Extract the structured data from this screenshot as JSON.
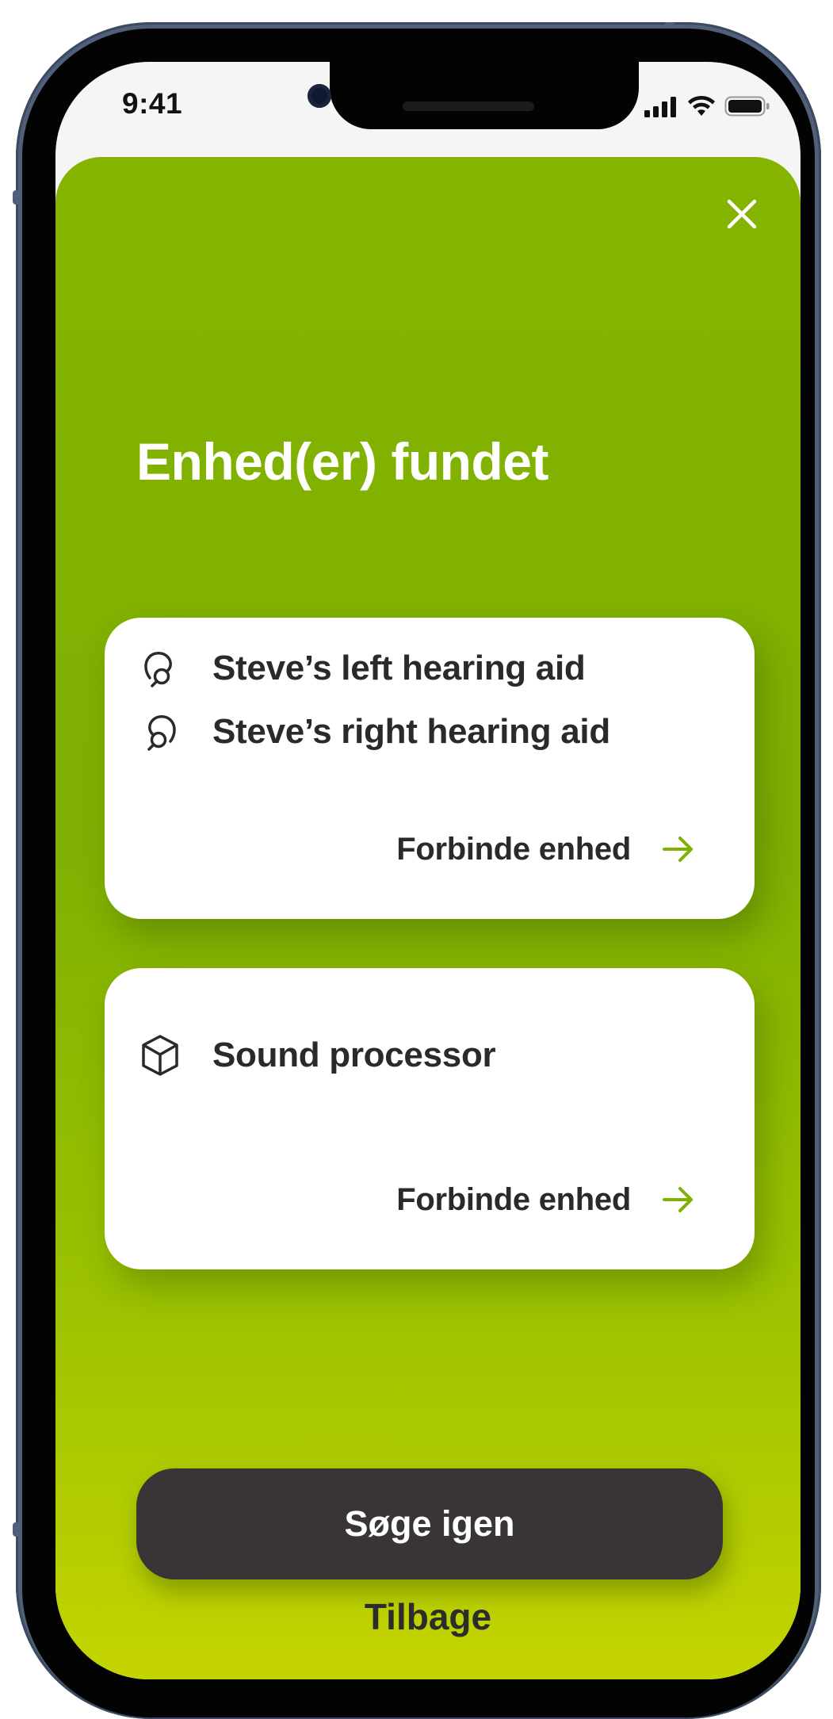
{
  "status_bar": {
    "time": "9:41"
  },
  "sheet": {
    "title": "Enhed(er) fundet",
    "accent_color": "#7fb002",
    "cards": [
      {
        "devices": [
          {
            "name": "Steve’s left hearing aid",
            "icon": "hearing-aid-left-icon"
          },
          {
            "name": "Steve’s right hearing aid",
            "icon": "hearing-aid-right-icon"
          }
        ],
        "action_label": "Forbinde enhed"
      },
      {
        "devices": [
          {
            "name": "Sound processor",
            "icon": "cube-icon"
          }
        ],
        "action_label": "Forbinde enhed"
      }
    ],
    "primary_button": "Søge igen",
    "secondary_link": "Tilbage"
  }
}
